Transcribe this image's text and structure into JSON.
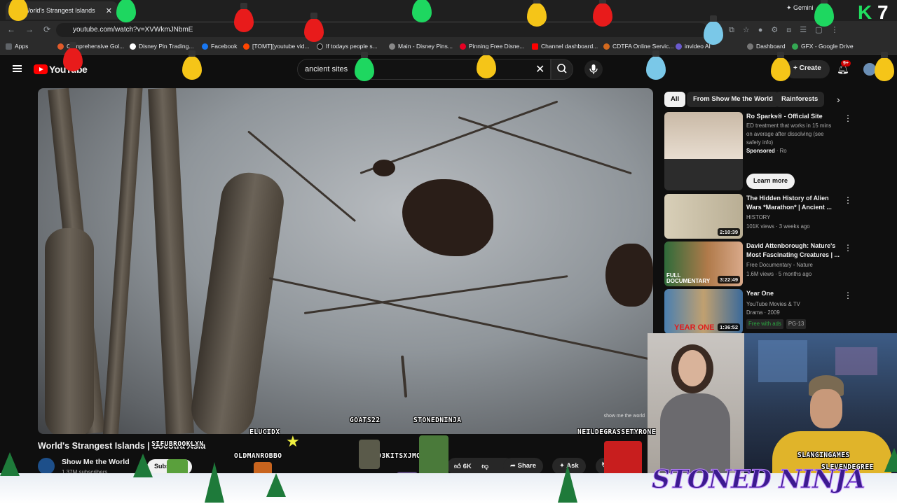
{
  "browser": {
    "tab_title": "World's Strangest Islands",
    "tab_close": "✕",
    "url": "youtube.com/watch?v=XVWkmJNbmE",
    "gemini_label": "✦ Gemini",
    "overlay_counter": "7",
    "bookmarks": [
      {
        "label": "Apps",
        "color": "#5f6368"
      },
      {
        "label": "Comprehensive Gol...",
        "color": "#e05a2a"
      },
      {
        "label": "Disney Pin Trading...",
        "color": "#ffffff"
      },
      {
        "label": "Facebook",
        "color": "#1877f2"
      },
      {
        "label": "[TOMT][youtube vid...",
        "color": "#ff4500"
      },
      {
        "label": "If todays people s...",
        "color": "#000000"
      },
      {
        "label": "Main - Disney Pins...",
        "color": "#888888"
      },
      {
        "label": "Pinning Free Disne...",
        "color": "#e60023"
      },
      {
        "label": "Channel dashboard...",
        "color": "#ff0000"
      },
      {
        "label": "CDTFA Online Servic...",
        "color": "#d2691e"
      },
      {
        "label": "invideo AI",
        "color": "#6a5acd"
      },
      {
        "label": "Dashboard",
        "color": "#444444"
      },
      {
        "label": "GFX - Google Drive",
        "color": "#34a853"
      }
    ]
  },
  "youtube": {
    "logo": "YouTube",
    "search_value": "ancient sites",
    "create_label": "Create",
    "notif_badge": "9+",
    "chips": [
      "All",
      "From Show Me the World",
      "Rainforests"
    ],
    "video": {
      "title": "World's Strangest Islands | Socotra Asia",
      "watermark": "show me the world",
      "channel": "Show Me the World",
      "subscribers": "1.37M subscribers",
      "subscribe_label": "Subscribe",
      "likes": "6K",
      "share_label": "Share",
      "ask_label": "Ask",
      "more_label": "⋯"
    },
    "recommendations": [
      {
        "title": "Ro Sparks® - Official Site",
        "desc": "ED treatment that works in 15 mins on average after dissolving (see safety info)",
        "sponsored": "Sponsored",
        "advertiser": "Ro",
        "cta": "Learn more"
      },
      {
        "title": "The Hidden History of Alien Wars *Marathon* | Ancient ...",
        "channel": "HISTORY",
        "meta": "101K views · 3 weeks ago",
        "duration": "2:10:39"
      },
      {
        "title": "David Attenborough: Nature's Most Fascinating Creatures | ...",
        "channel": "Free Documentary - Nature",
        "meta": "1.6M views · 5 months ago",
        "duration": "3:22:49",
        "thumb_text": "FULL DOCUMENTARY"
      },
      {
        "title": "Year One",
        "channel": "YouTube Movies & TV",
        "meta": "Drama · 2009",
        "badges": [
          "Free with ads",
          "PG-13"
        ],
        "duration": "1:36:52",
        "thumb_text": "YEAR ONE"
      }
    ]
  },
  "overlay": {
    "usernames": [
      "ELUCIDX",
      "GOATS22",
      "STONEDNINJA",
      "NEILDEGRASSETYRONE",
      "SIFUBROOKLYN",
      "OLDMANROBBO",
      "H03KITSXJMONEY",
      "SLANGINGAMES",
      "SLEVENDEGREE"
    ],
    "brand": "STONED NINJA"
  }
}
